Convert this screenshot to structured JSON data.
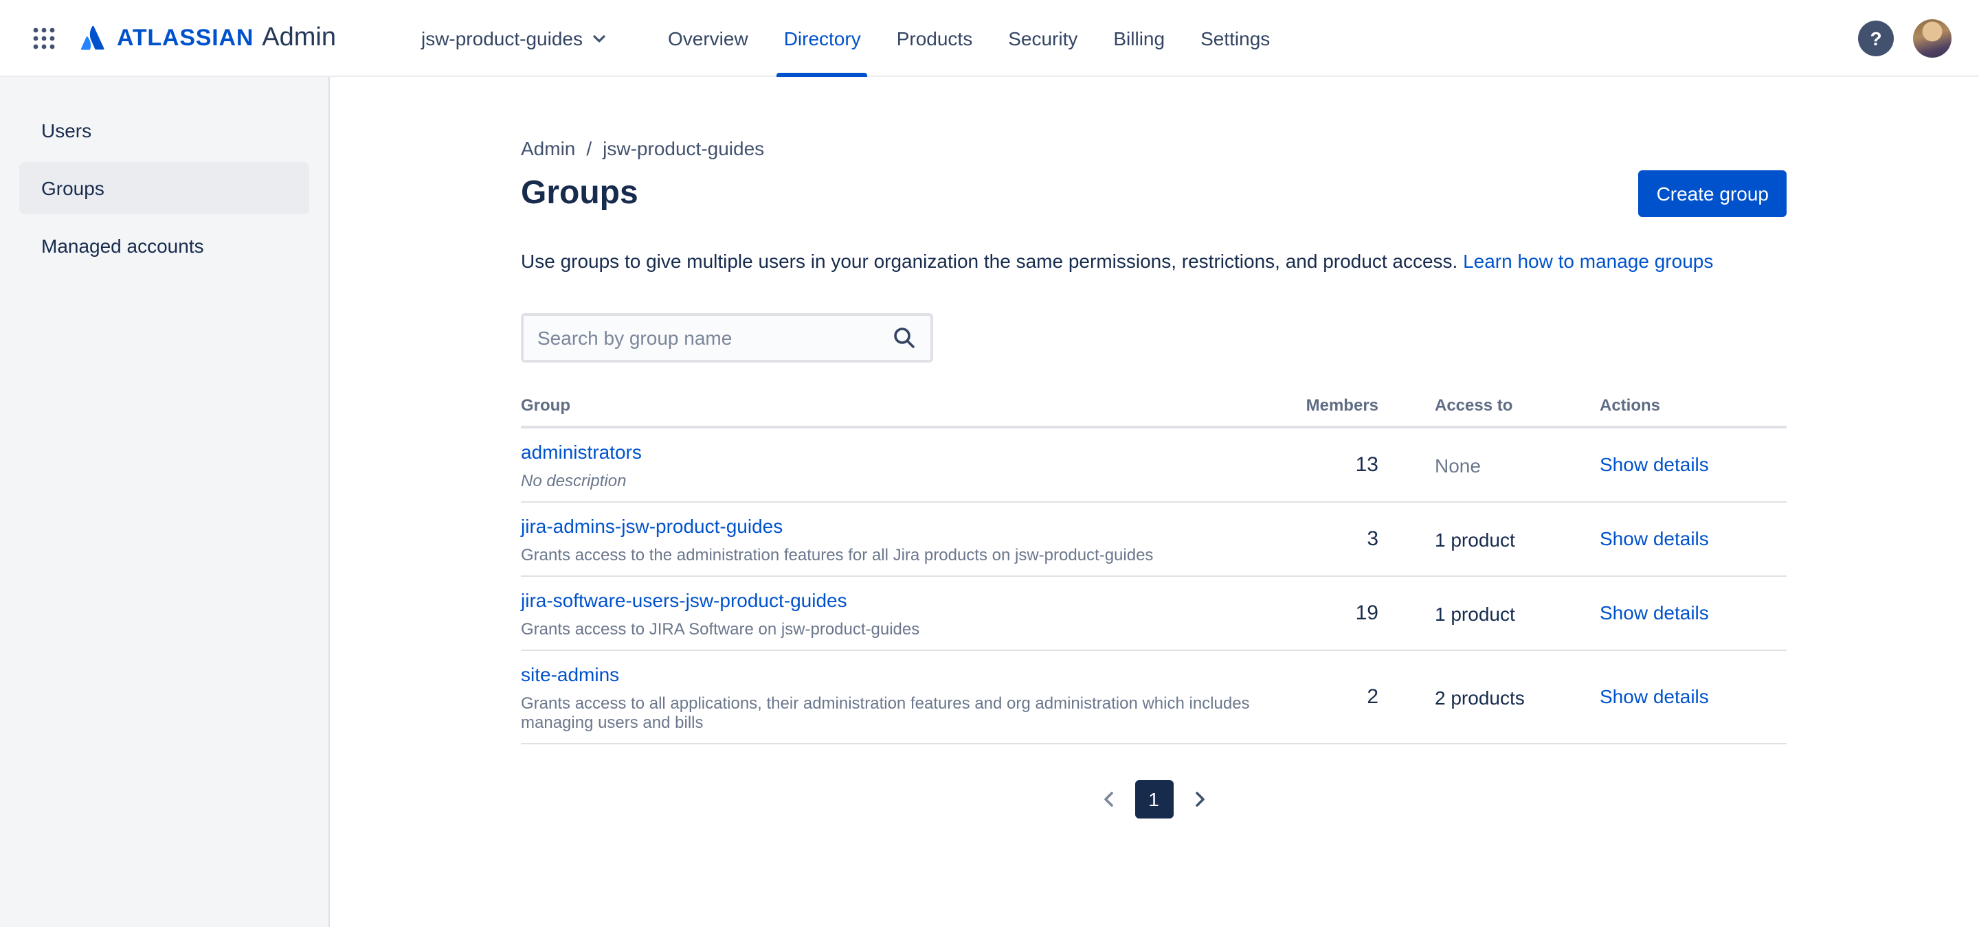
{
  "topbar": {
    "brand_name": "ATLASSIAN",
    "brand_suffix": "Admin",
    "org_selector": "jsw-product-guides",
    "help_label": "?",
    "nav": [
      {
        "label": "Overview",
        "active": false
      },
      {
        "label": "Directory",
        "active": true
      },
      {
        "label": "Products",
        "active": false
      },
      {
        "label": "Security",
        "active": false
      },
      {
        "label": "Billing",
        "active": false
      },
      {
        "label": "Settings",
        "active": false
      }
    ]
  },
  "sidebar": {
    "items": [
      {
        "label": "Users",
        "active": false
      },
      {
        "label": "Groups",
        "active": true
      },
      {
        "label": "Managed accounts",
        "active": false
      }
    ]
  },
  "main": {
    "breadcrumb": {
      "items": [
        "Admin",
        "jsw-product-guides"
      ],
      "separator": "/"
    },
    "title": "Groups",
    "create_button_label": "Create group",
    "description": "Use groups to give multiple users in your organization the same permissions, restrictions, and product access.",
    "learn_link_label": "Learn how to manage groups",
    "search": {
      "placeholder": "Search by group name"
    },
    "table": {
      "headers": {
        "group": "Group",
        "members": "Members",
        "access": "Access to",
        "actions": "Actions"
      },
      "rows": [
        {
          "name": "administrators",
          "description": "No description",
          "members": "13",
          "access": "None",
          "action": "Show details"
        },
        {
          "name": "jira-admins-jsw-product-guides",
          "description": "Grants access to the administration features for all Jira products on jsw-product-guides",
          "members": "3",
          "access": "1 product",
          "action": "Show details"
        },
        {
          "name": "jira-software-users-jsw-product-guides",
          "description": "Grants access to JIRA Software on jsw-product-guides",
          "members": "19",
          "access": "1 product",
          "action": "Show details"
        },
        {
          "name": "site-admins",
          "description": "Grants access to all applications, their administration features and org administration which includes managing users and bills",
          "members": "2",
          "access": "2 products",
          "action": "Show details"
        }
      ]
    },
    "pagination": {
      "current": "1"
    }
  },
  "colors": {
    "accent": "#0052CC",
    "link": "#0052CC",
    "nav_active": "#0052CC",
    "text_primary": "#172B4D",
    "text_muted": "#6B778C",
    "sidebar_bg": "#F4F5F7",
    "sidebar_selected_bg": "#EBECF0",
    "divider": "#DFE1E6",
    "pagination_current_bg": "#172B4D"
  }
}
